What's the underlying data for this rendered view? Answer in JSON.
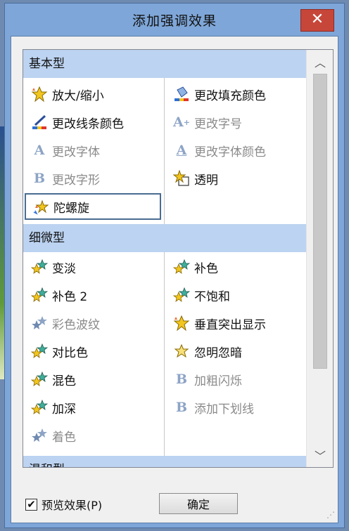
{
  "window": {
    "title": "添加强调效果",
    "close_label": "✕"
  },
  "categories": [
    {
      "label": "基本型",
      "items_left": [
        {
          "label": "放大/缩小",
          "icon": "star-burst-icon",
          "disabled": false
        },
        {
          "label": "更改线条颜色",
          "icon": "pen-color-icon",
          "disabled": false
        },
        {
          "label": "更改字体",
          "icon": "font-a-icon",
          "disabled": true
        },
        {
          "label": "更改字形",
          "icon": "bold-b-icon",
          "disabled": true
        },
        {
          "label": "陀螺旋",
          "icon": "spin-star-icon",
          "disabled": false,
          "selected": true
        }
      ],
      "items_right": [
        {
          "label": "更改填充颜色",
          "icon": "paint-bucket-icon",
          "disabled": false
        },
        {
          "label": "更改字号",
          "icon": "font-size-icon",
          "disabled": true
        },
        {
          "label": "更改字体颜色",
          "icon": "font-color-icon",
          "disabled": true
        },
        {
          "label": "透明",
          "icon": "transparent-star-icon",
          "disabled": false
        }
      ]
    },
    {
      "label": "细微型",
      "items_left": [
        {
          "label": "变淡",
          "icon": "star-pair-icon",
          "disabled": false
        },
        {
          "label": "补色 2",
          "icon": "star-pair-icon",
          "disabled": false
        },
        {
          "label": "彩色波纹",
          "icon": "star-pair-icon",
          "disabled": true
        },
        {
          "label": "对比色",
          "icon": "star-pair-icon",
          "disabled": false
        },
        {
          "label": "混色",
          "icon": "star-pair-icon",
          "disabled": false
        },
        {
          "label": "加深",
          "icon": "star-pair-icon",
          "disabled": false
        },
        {
          "label": "着色",
          "icon": "star-pair-icon",
          "disabled": true
        }
      ],
      "items_right": [
        {
          "label": "补色",
          "icon": "star-pair-icon",
          "disabled": false
        },
        {
          "label": "不饱和",
          "icon": "star-pair-icon",
          "disabled": false
        },
        {
          "label": "垂直突出显示",
          "icon": "star-burst-icon",
          "disabled": false
        },
        {
          "label": "忽明忽暗",
          "icon": "star-flash-icon",
          "disabled": false
        },
        {
          "label": "加粗闪烁",
          "icon": "bold-b-icon",
          "disabled": true
        },
        {
          "label": "添加下划线",
          "icon": "bold-b-icon",
          "disabled": true
        }
      ]
    },
    {
      "label": "温和型"
    }
  ],
  "footer": {
    "preview_label": "预览效果(P)",
    "preview_checked": true,
    "ok_label": "确定"
  },
  "colors": {
    "accent": "#7ea6d8",
    "category_bg": "#bcd3f1",
    "close_red": "#c7463a"
  }
}
